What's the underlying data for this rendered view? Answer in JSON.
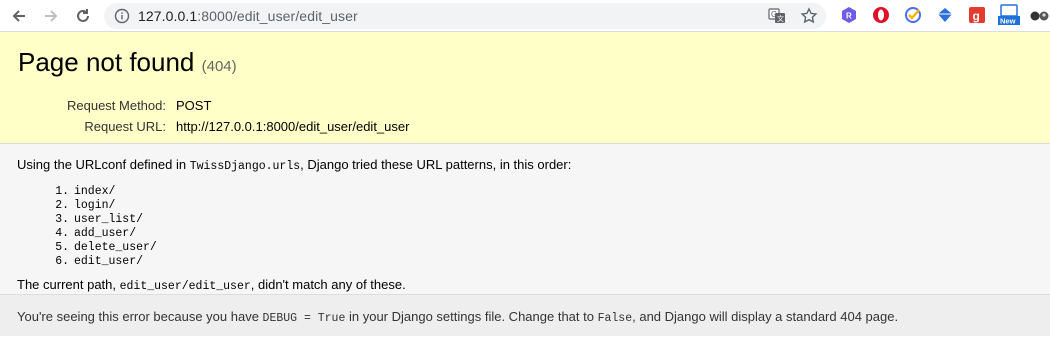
{
  "browser": {
    "url_host": "127.0.0.1",
    "url_rest": ":8000/edit_user/edit_user",
    "extensions": [
      "translate-icon",
      "bookmark-star-icon",
      "r-extension-icon",
      "opera-icon",
      "checkmark-extension-icon",
      "diamond-extension-icon",
      "g-extension-icon",
      "new-extension-icon",
      "glasses-extension-icon"
    ],
    "new_badge": "New"
  },
  "summary": {
    "title": "Page not found",
    "code": "(404)",
    "method_label": "Request Method:",
    "method_value": "POST",
    "url_label": "Request URL:",
    "url_value": "http://127.0.0.1:8000/edit_user/edit_user"
  },
  "info": {
    "intro_before": "Using the URLconf defined in ",
    "urlconf": "TwissDjango.urls",
    "intro_after": ", Django tried these URL patterns, in this order:",
    "patterns": [
      {
        "num": "1.",
        "path": "index/"
      },
      {
        "num": "2.",
        "path": "login/"
      },
      {
        "num": "3.",
        "path": "user_list/"
      },
      {
        "num": "4.",
        "path": "add_user/"
      },
      {
        "num": "5.",
        "path": "delete_user/"
      },
      {
        "num": "6.",
        "path": "edit_user/"
      }
    ],
    "current_before": "The current path, ",
    "current_path": "edit_user/edit_user",
    "current_after": ", didn't match any of these."
  },
  "explanation": {
    "part1": "You're seeing this error because you have ",
    "debug": "DEBUG = True",
    "part2": " in your Django settings file. Change that to ",
    "false": "False",
    "part3": ", and Django will display a standard 404 page."
  },
  "colors": {
    "summary_bg": "#ffffc8",
    "info_bg": "#f6f6f6",
    "explanation_bg": "#eeeeee",
    "omnibox_bg": "#f1f3f4"
  }
}
